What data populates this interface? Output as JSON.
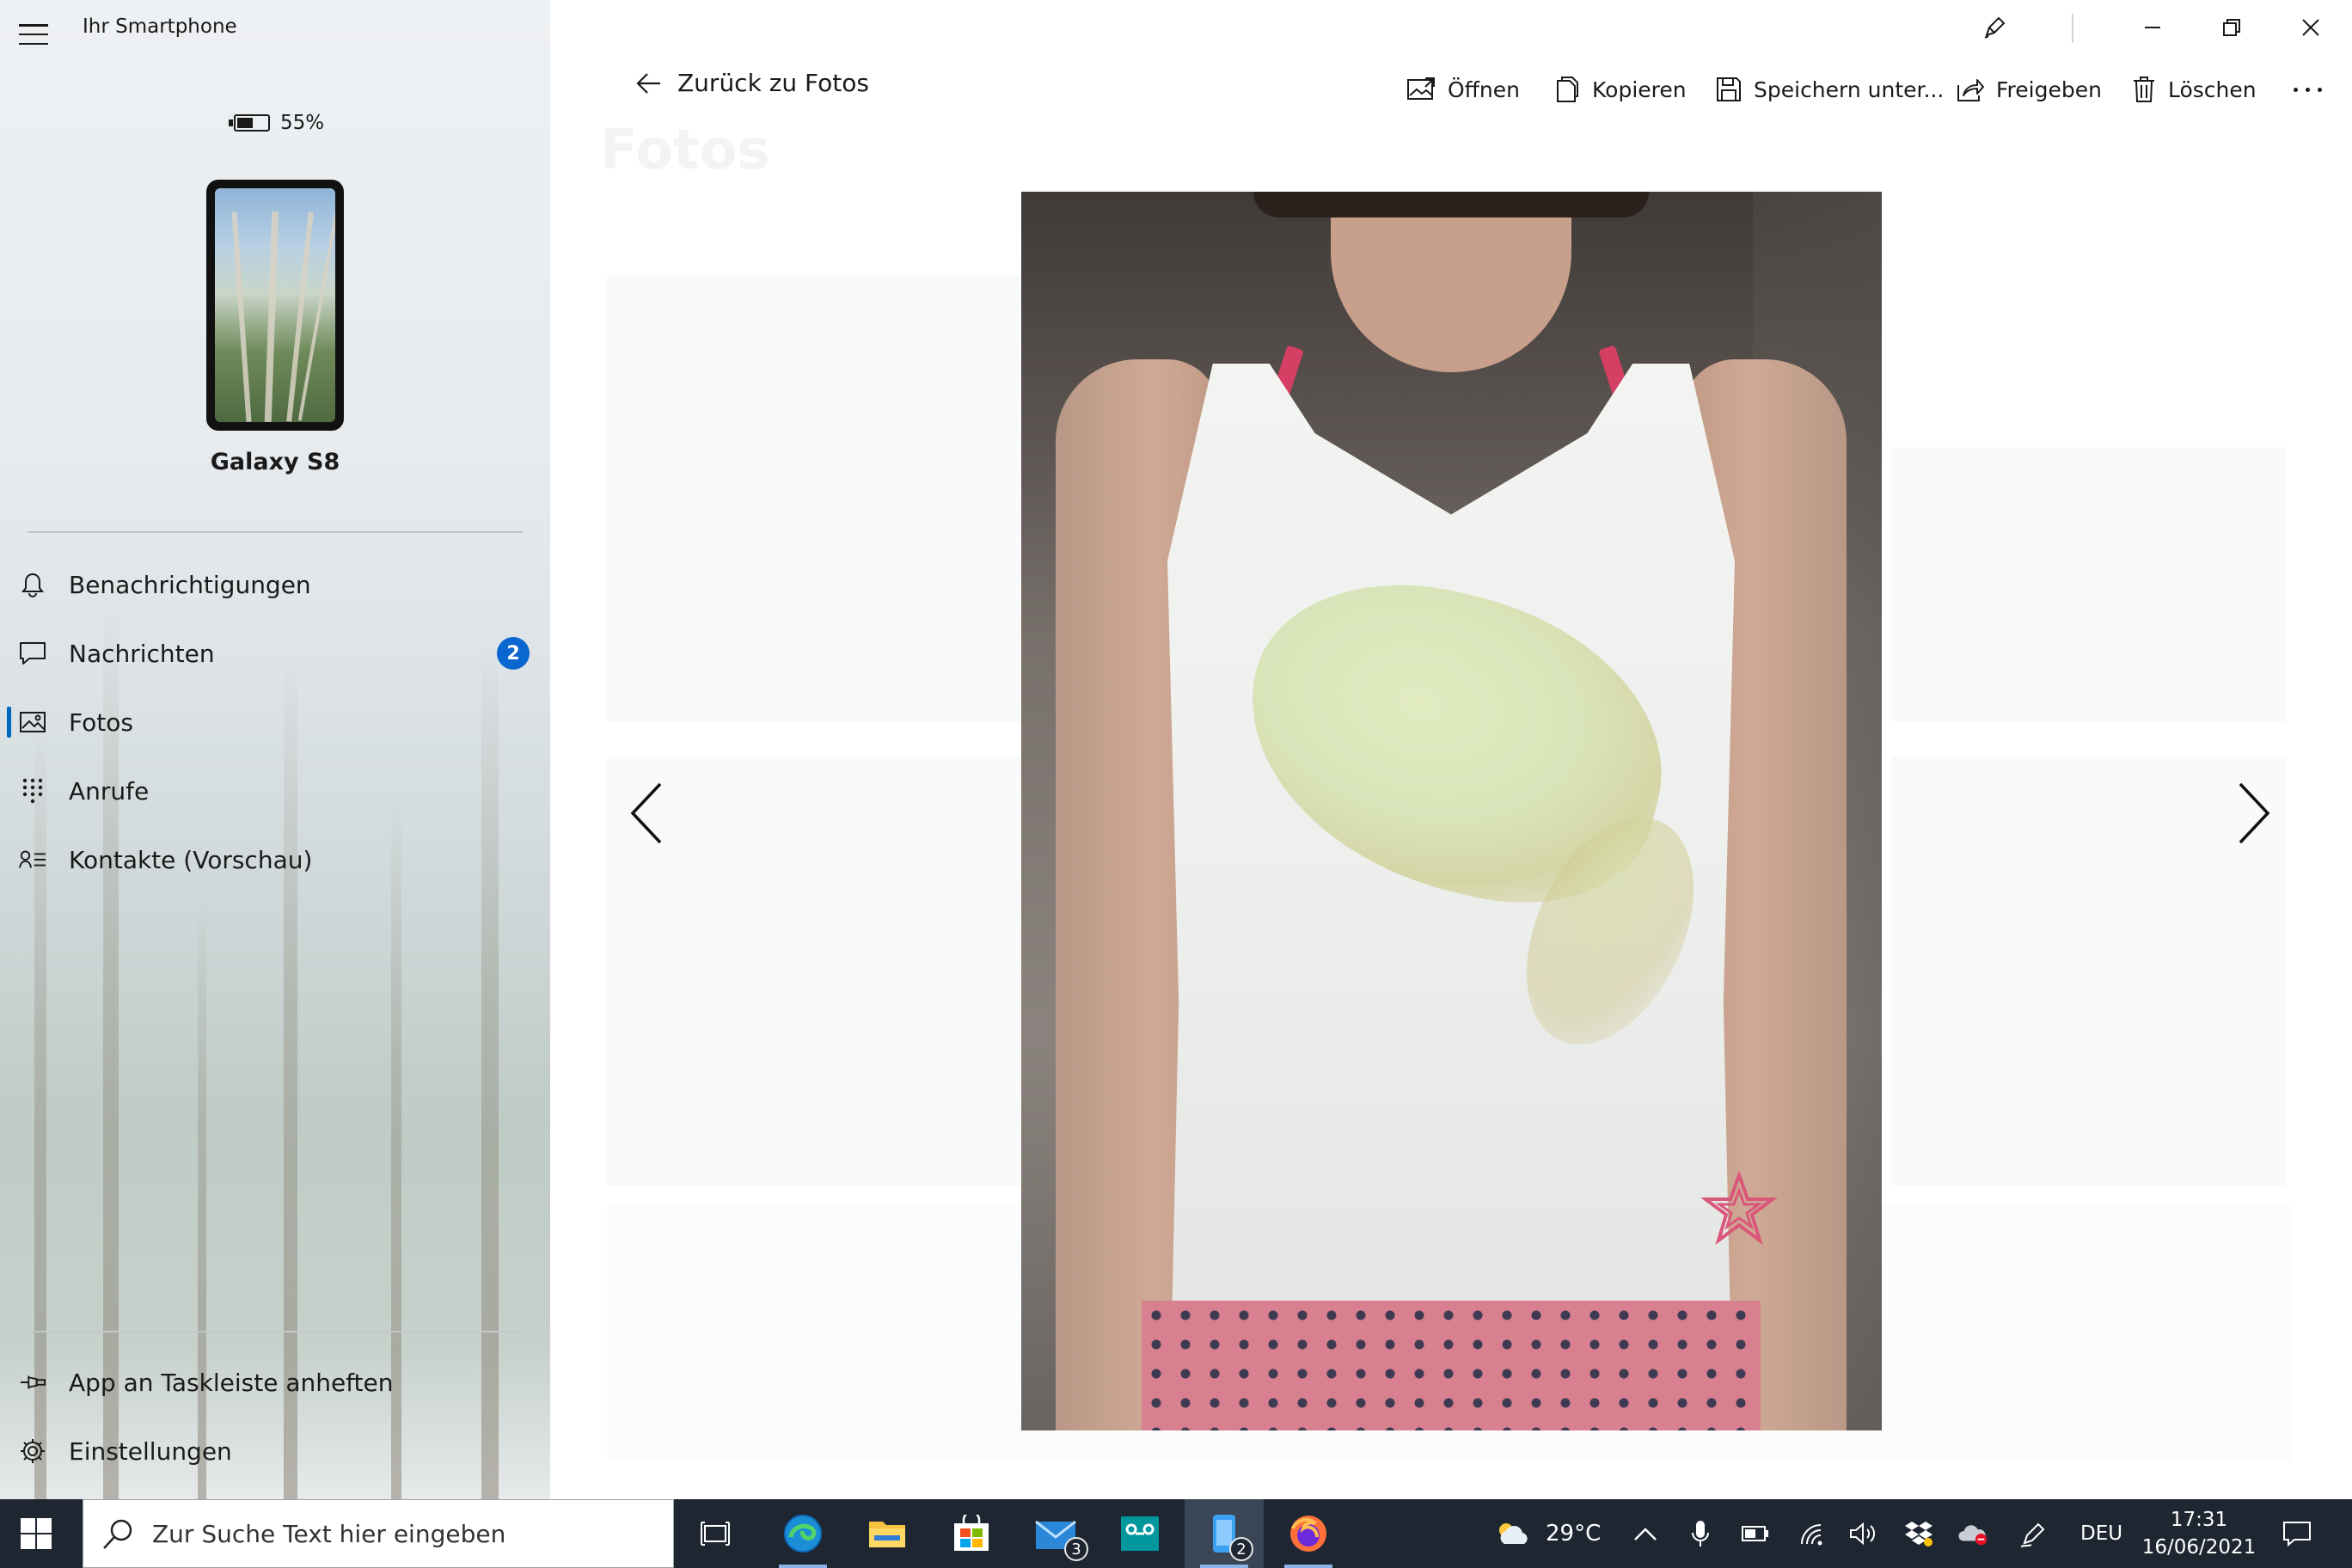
{
  "window": {
    "title": "Ihr Smartphone"
  },
  "sidebar": {
    "battery_text": "55%",
    "battery_level": 0.55,
    "device_name": "Galaxy S8",
    "nav": [
      {
        "label": "Benachrichtigungen",
        "icon": "bell-icon"
      },
      {
        "label": "Nachrichten",
        "icon": "message-icon",
        "badge": "2"
      },
      {
        "label": "Fotos",
        "icon": "photos-icon",
        "active": true
      },
      {
        "label": "Anrufe",
        "icon": "dialpad-icon"
      },
      {
        "label": "Kontakte (Vorschau)",
        "icon": "contacts-icon"
      }
    ],
    "bottom": [
      {
        "label": "App an Taskleiste anheften",
        "icon": "pin-icon"
      },
      {
        "label": "Einstellungen",
        "icon": "gear-icon"
      }
    ]
  },
  "viewer": {
    "back_label": "Zurück zu Fotos",
    "background_title": "Fotos",
    "toolbar": {
      "open": "Öffnen",
      "copy": "Kopieren",
      "save_as": "Speichern unter...",
      "share": "Freigeben",
      "delete": "Löschen"
    }
  },
  "taskbar": {
    "search_placeholder": "Zur Suche Text hier eingeben",
    "mail_count": "3",
    "yourphone_count": "2",
    "weather_temp": "29°C",
    "language": "DEU",
    "time": "17:31",
    "date": "16/06/2021"
  },
  "colors": {
    "accent": "#0a66d0",
    "taskbar": "#1e2632",
    "active_indicator": "#0067c0"
  }
}
